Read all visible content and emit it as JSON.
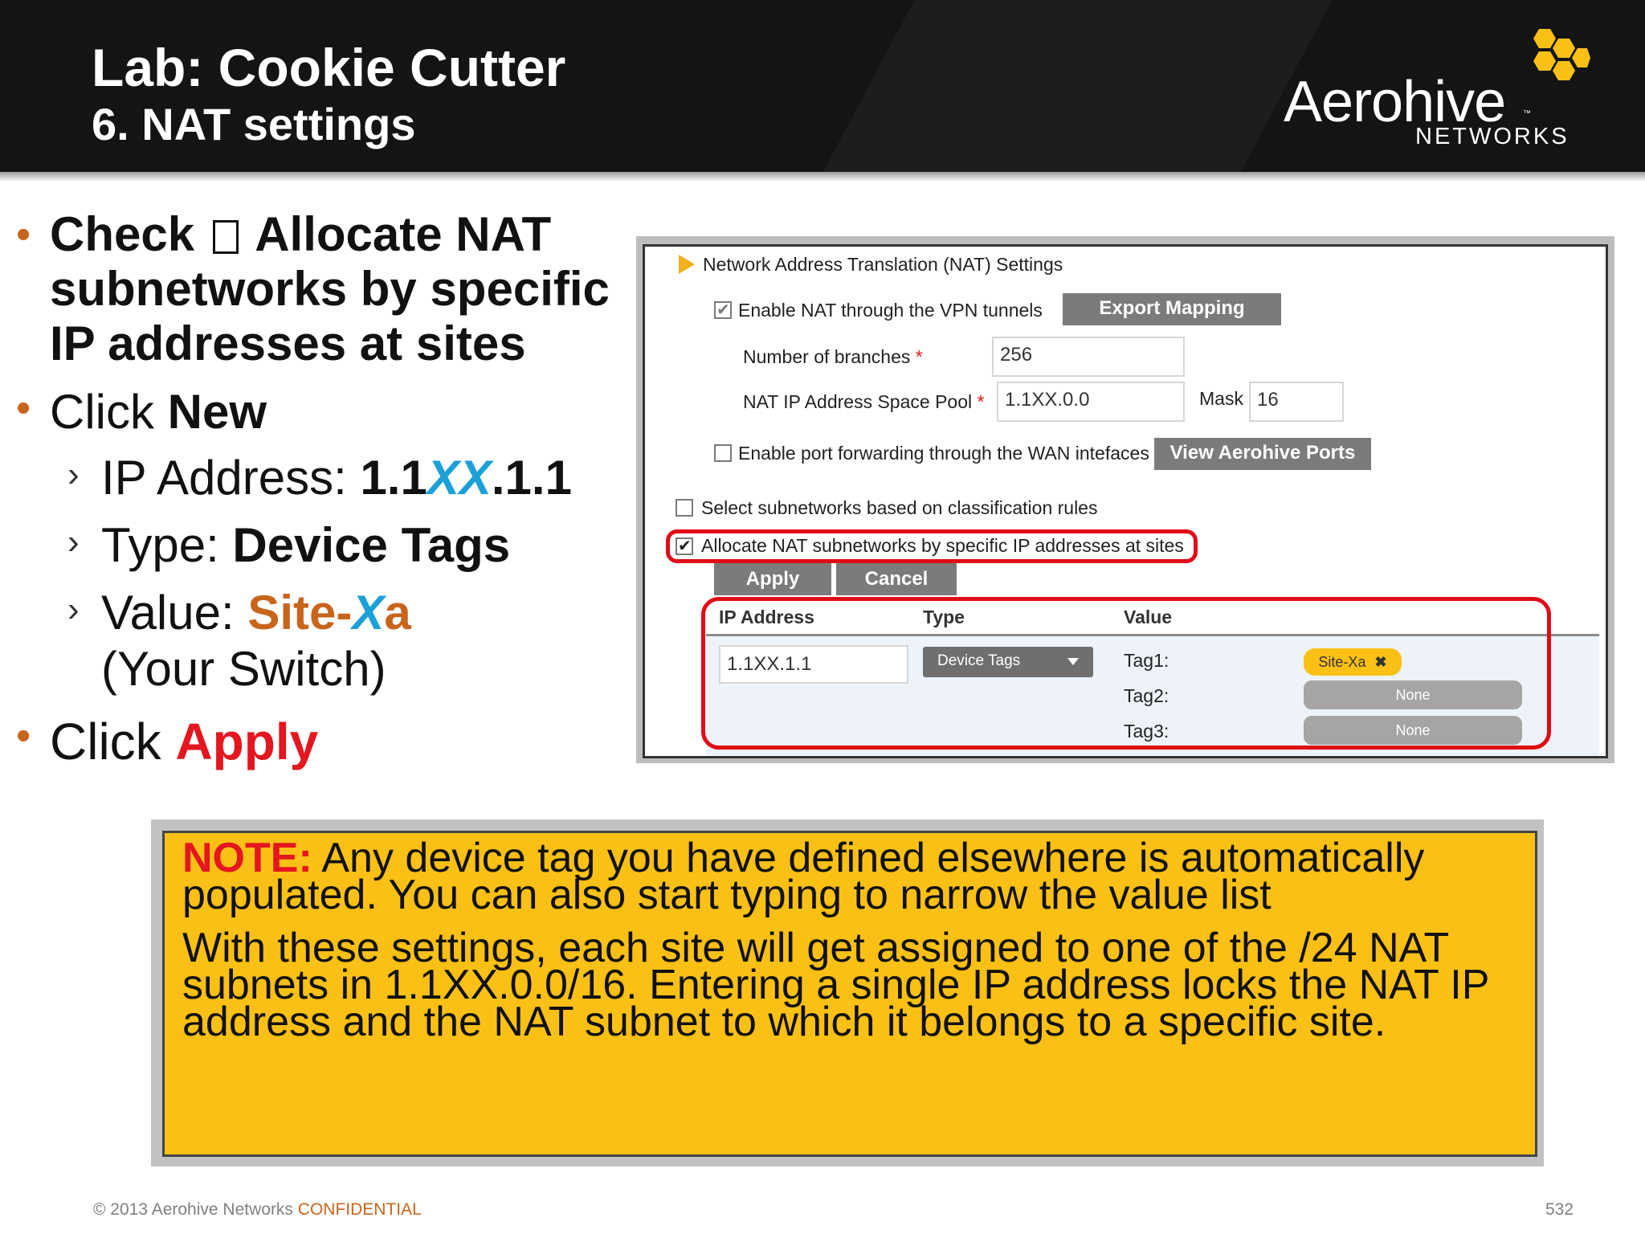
{
  "header": {
    "title": "Lab: Cookie Cutter",
    "subtitle": "6. NAT settings",
    "logo_word": "Aerohive",
    "logo_tm": "™",
    "logo_sub": "NETWORKS"
  },
  "bullets": {
    "b1_pre": "Check",
    "b1_post": "Allocate NAT subnetworks by specific IP addresses at sites",
    "b2_pre": "Click ",
    "b2_bold": "New",
    "ip_label": "IP Address: ",
    "ip_a": "1.1",
    "ip_b": "XX",
    "ip_c": ".1.1",
    "type_label": "Type: ",
    "type_value": "Device Tags",
    "value_label": "Value: ",
    "value_a": "Site-",
    "value_b": "X",
    "value_c": "a",
    "value_note": "(Your Switch)",
    "b3_pre": "Click ",
    "b3_bold": "Apply",
    "bullet_glyph": "•",
    "sub_glyph": "›"
  },
  "panel": {
    "section_title": "Network Address Translation (NAT) Settings",
    "enable_nat_label": "Enable NAT through the VPN tunnels",
    "export_mapping": "Export Mapping",
    "branches_label": "Number of branches",
    "branches_value": "256",
    "pool_label": "NAT IP Address Space Pool",
    "pool_value": "1.1XX.0.0",
    "mask_label": "Mask",
    "mask_value": "16",
    "required_mark": "*",
    "port_fwd_label": "Enable port forwarding through the WAN intefaces",
    "view_ports": "View Aerohive Ports",
    "select_subnets_label": "Select subnetworks based on classification rules",
    "allocate_label": "Allocate NAT subnetworks by specific IP addresses at sites",
    "apply": "Apply",
    "cancel": "Cancel",
    "col_ip": "IP Address",
    "col_type": "Type",
    "col_value": "Value",
    "row_ip": "1.1XX.1.1",
    "row_type": "Device Tags",
    "tag1": "Tag1:",
    "tag2": "Tag2:",
    "tag3": "Tag3:",
    "tag1_value": "Site-Xa",
    "tag_remove": "✖",
    "none": "None"
  },
  "note": {
    "label": "NOTE:",
    "line1": " Any device tag you have defined elsewhere is automatically populated. You can also start typing to narrow the value list",
    "line2": "With these settings, each site will get assigned to one of the /24 NAT subnets in 1.1XX.0.0/16. Entering a single IP address locks the NAT IP address and the NAT subnet to which it belongs to a specific site."
  },
  "footer": {
    "copyright": "© 2013 Aerohive Networks ",
    "confidential": "CONFIDENTIAL",
    "page": "532"
  },
  "colors": {
    "accent_orange": "#c8651d",
    "accent_red": "#e4161f",
    "accent_blue": "#1ba0d8",
    "note_yellow": "#fbc016",
    "highlight_red": "#e10b17"
  }
}
